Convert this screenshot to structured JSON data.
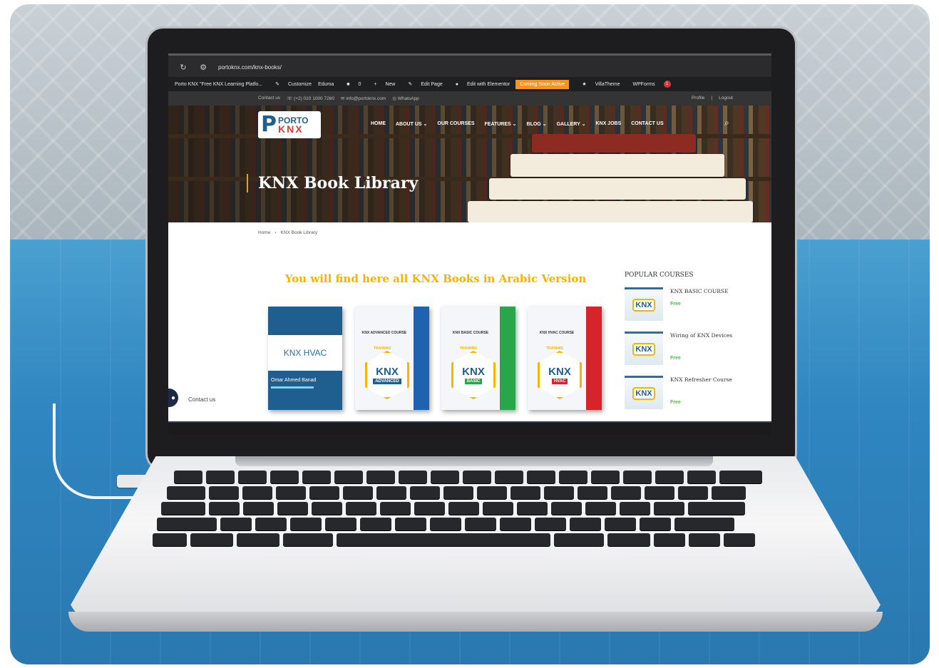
{
  "browser": {
    "url": "portoknx.com/knx-books/"
  },
  "wp_admin_bar": {
    "site": "Porto KNX \"Free KNX Learning Platfo...",
    "customize": "Customize",
    "eduma": "Eduma",
    "comments": "0",
    "new": "New",
    "edit_page": "Edit Page",
    "edit_elementor": "Edit with Elementor",
    "coming_soon": "Coming Soon Active",
    "villatheme": "VillaTheme",
    "wpforms": "WPForms",
    "wpforms_badge": "1"
  },
  "top_info": {
    "contact": "Contact us",
    "phone": "(+2) 010 1000 7260",
    "email": "info@portoknx.com",
    "whatsapp": "WhatsApp",
    "profile": "Profile",
    "separator": "|",
    "logout": "Logout"
  },
  "logo": {
    "p": "P",
    "line1": "PORTO",
    "line2": "KNX"
  },
  "nav": {
    "home": "HOME",
    "about": "ABOUT US",
    "courses": "OUR COURSES",
    "features": "FEATURES",
    "blog": "BLOG",
    "gallery": "GALLERY",
    "jobs": "KNX JOBS",
    "contact": "CONTACT US"
  },
  "hero": {
    "title": "KNX Book Library"
  },
  "breadcrumb": {
    "home": "Home",
    "sep": "›",
    "current": "KNX Book Library"
  },
  "main": {
    "headline": "You will find here all KNX Books in Arabic Version"
  },
  "books": [
    {
      "title": "KNX HVAC",
      "author": "Omar Ahmed Banad"
    },
    {
      "caption": "KNX ADVANCED COURSE",
      "training": "TRAINING",
      "tag": "ADVANCED",
      "tag_color": "#1f5f8f",
      "spine_color": "#1e63b0"
    },
    {
      "caption": "KNX BASIC COURSE",
      "training": "TRAINING",
      "tag": "BASIC",
      "tag_color": "#2aa64a",
      "spine_color": "#2aa64a"
    },
    {
      "caption": "KNX HVAC COURSE",
      "training": "TRAINING",
      "tag": "HVAC",
      "tag_color": "#d8232a",
      "spine_color": "#d8232a"
    }
  ],
  "sidebar": {
    "heading": "POPULAR COURSES",
    "courses": [
      {
        "name": "KNX BASIC COURSE",
        "price": "Free",
        "thumb": "KNX"
      },
      {
        "name": "Wiring of KNX Devices",
        "price": "Free",
        "thumb": "KNX"
      },
      {
        "name": "KNX Refresher Course",
        "price": "Free",
        "thumb": "KNX"
      }
    ]
  },
  "contact_float": {
    "label": "Contact us"
  },
  "colors": {
    "accent": "#f5b400",
    "brand_blue": "#1f5f8f",
    "brand_red": "#e53935",
    "free_green": "#33cc33",
    "coming_soon": "#f7941d"
  }
}
